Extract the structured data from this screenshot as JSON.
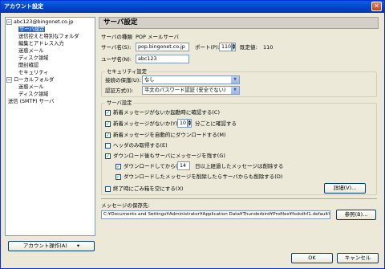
{
  "window": {
    "title": "アカウント設定",
    "close_glyph": "✕"
  },
  "tree": {
    "items": [
      {
        "label": "abc123@bingonet.co.jp",
        "level": 0,
        "expander": "−",
        "selected": false
      },
      {
        "label": "サーバ設定",
        "level": 1,
        "selected": true
      },
      {
        "label": "送信控えと特別なフォルダ",
        "level": 1,
        "selected": false
      },
      {
        "label": "編集とアドレス入力",
        "level": 1,
        "selected": false
      },
      {
        "label": "迷惑メール",
        "level": 1,
        "selected": false
      },
      {
        "label": "ディスク領域",
        "level": 1,
        "selected": false
      },
      {
        "label": "開封確認",
        "level": 1,
        "selected": false
      },
      {
        "label": "セキュリティ",
        "level": 1,
        "selected": false
      },
      {
        "label": "ローカルフォルダ",
        "level": 0,
        "expander": "−",
        "selected": false
      },
      {
        "label": "迷惑メール",
        "level": 1,
        "selected": false
      },
      {
        "label": "ディスク領域",
        "level": 1,
        "selected": false
      },
      {
        "label": "送信 (SMTP) サーバ",
        "level": 0,
        "selected": false
      }
    ],
    "account_actions_label": "アカウント操作(A)",
    "account_actions_arrow": "▾"
  },
  "panel": {
    "title": "サーバ設定",
    "server_type_label": "サーバの種類",
    "server_type_value": "POP メールサーバ",
    "server_name_label": "サーバ名(S):",
    "server_name_value": "pop.bingonet.co.jp",
    "port_label": "ポート(P):",
    "port_value": "110",
    "default_port_label": "既定値:",
    "default_port_value": "110",
    "username_label": "ユーザ名(N):",
    "username_value": "abc123",
    "security": {
      "title": "セキュリティ設定",
      "connection_label": "接続の保護(U):",
      "connection_value": "なし",
      "auth_label": "認証方式(I):",
      "auth_value": "平文のパスワード認証 (安全でない)"
    },
    "server": {
      "title": "サーバ設定",
      "check_on_startup": "新着メッセージがないか起動時に確認する(C)",
      "check_every_prefix": "新着メッセージがないか(Y)",
      "check_every_value": "10",
      "check_every_suffix": "分ごとに確認する",
      "auto_download": "新着メッセージを自動的にダウンロードする(M)",
      "headers_only": "ヘッダのみ取得する(E)",
      "leave_on_server": "ダウンロード後もサーバにメッセージを残す(G)",
      "delete_after_prefix": "ダウンロードしてから(O)",
      "delete_after_value": "14",
      "delete_after_suffix": "日以上経過したメッセージは削除する",
      "delete_when_deleted": "ダウンロードしたメッセージを削除したらサーバからも削除する(D)",
      "empty_trash": "終了時にごみ箱を空にする(X)",
      "advanced_button": "詳細(V)..."
    },
    "storage": {
      "label": "メッセージの保存先:",
      "path": "C:¥Documents and Settings¥Administrator¥Application Data¥Thunderbird¥Profiles¥fsskdhf1.default¥M",
      "browse_button": "参照(B)..."
    }
  },
  "footer": {
    "ok_label": "OK",
    "cancel_label": "キャンセル"
  },
  "check_glyph": "✓",
  "spin_up": "▲",
  "spin_down": "▼",
  "select_arrow": "▼"
}
